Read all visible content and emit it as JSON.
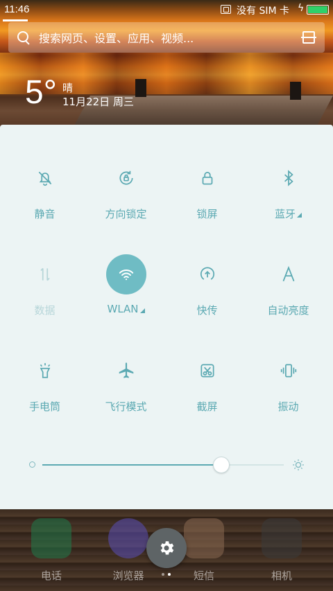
{
  "status_bar": {
    "time": "11:46",
    "sim_text": "没有 SIM 卡",
    "battery_color": "#2fd06a"
  },
  "search": {
    "placeholder": "搜索网页、设置、应用、视频..."
  },
  "weather": {
    "temperature": "5°",
    "condition": "晴",
    "date": "11月22日 周三"
  },
  "quick_settings": {
    "accent_color": "#5ba9b2",
    "tiles": [
      {
        "label": "静音",
        "icon": "bell-off-icon",
        "active": false,
        "enabled": true
      },
      {
        "label": "方向锁定",
        "icon": "rotation-lock-icon",
        "active": false,
        "enabled": true
      },
      {
        "label": "锁屏",
        "icon": "lock-icon",
        "active": false,
        "enabled": true
      },
      {
        "label": "蓝牙",
        "icon": "bluetooth-icon",
        "active": false,
        "enabled": true,
        "expandable": true
      },
      {
        "label": "数据",
        "icon": "mobile-data-icon",
        "active": false,
        "enabled": false
      },
      {
        "label": "WLAN",
        "icon": "wifi-icon",
        "active": true,
        "enabled": true,
        "expandable": true
      },
      {
        "label": "快传",
        "icon": "quick-transfer-icon",
        "active": false,
        "enabled": true
      },
      {
        "label": "自动亮度",
        "icon": "auto-brightness-icon",
        "active": false,
        "enabled": true
      },
      {
        "label": "手电筒",
        "icon": "flashlight-icon",
        "active": false,
        "enabled": true
      },
      {
        "label": "飞行模式",
        "icon": "airplane-icon",
        "active": false,
        "enabled": true
      },
      {
        "label": "截屏",
        "icon": "screenshot-icon",
        "active": false,
        "enabled": true
      },
      {
        "label": "振动",
        "icon": "vibrate-icon",
        "active": false,
        "enabled": true
      }
    ],
    "brightness_level": 0.74
  },
  "home_apps": [
    {
      "label": "电话",
      "icon": "phone-app-icon",
      "color": "#1f7a4a"
    },
    {
      "label": "浏览器",
      "icon": "browser-app-icon",
      "color": "#5a4fb8"
    },
    {
      "label": "短信",
      "icon": "sms-app-icon",
      "color": "#8a6a52"
    },
    {
      "label": "相机",
      "icon": "camera-app-icon",
      "color": "#3a3a3a"
    }
  ],
  "pager": {
    "pages": 2,
    "current": 2
  }
}
